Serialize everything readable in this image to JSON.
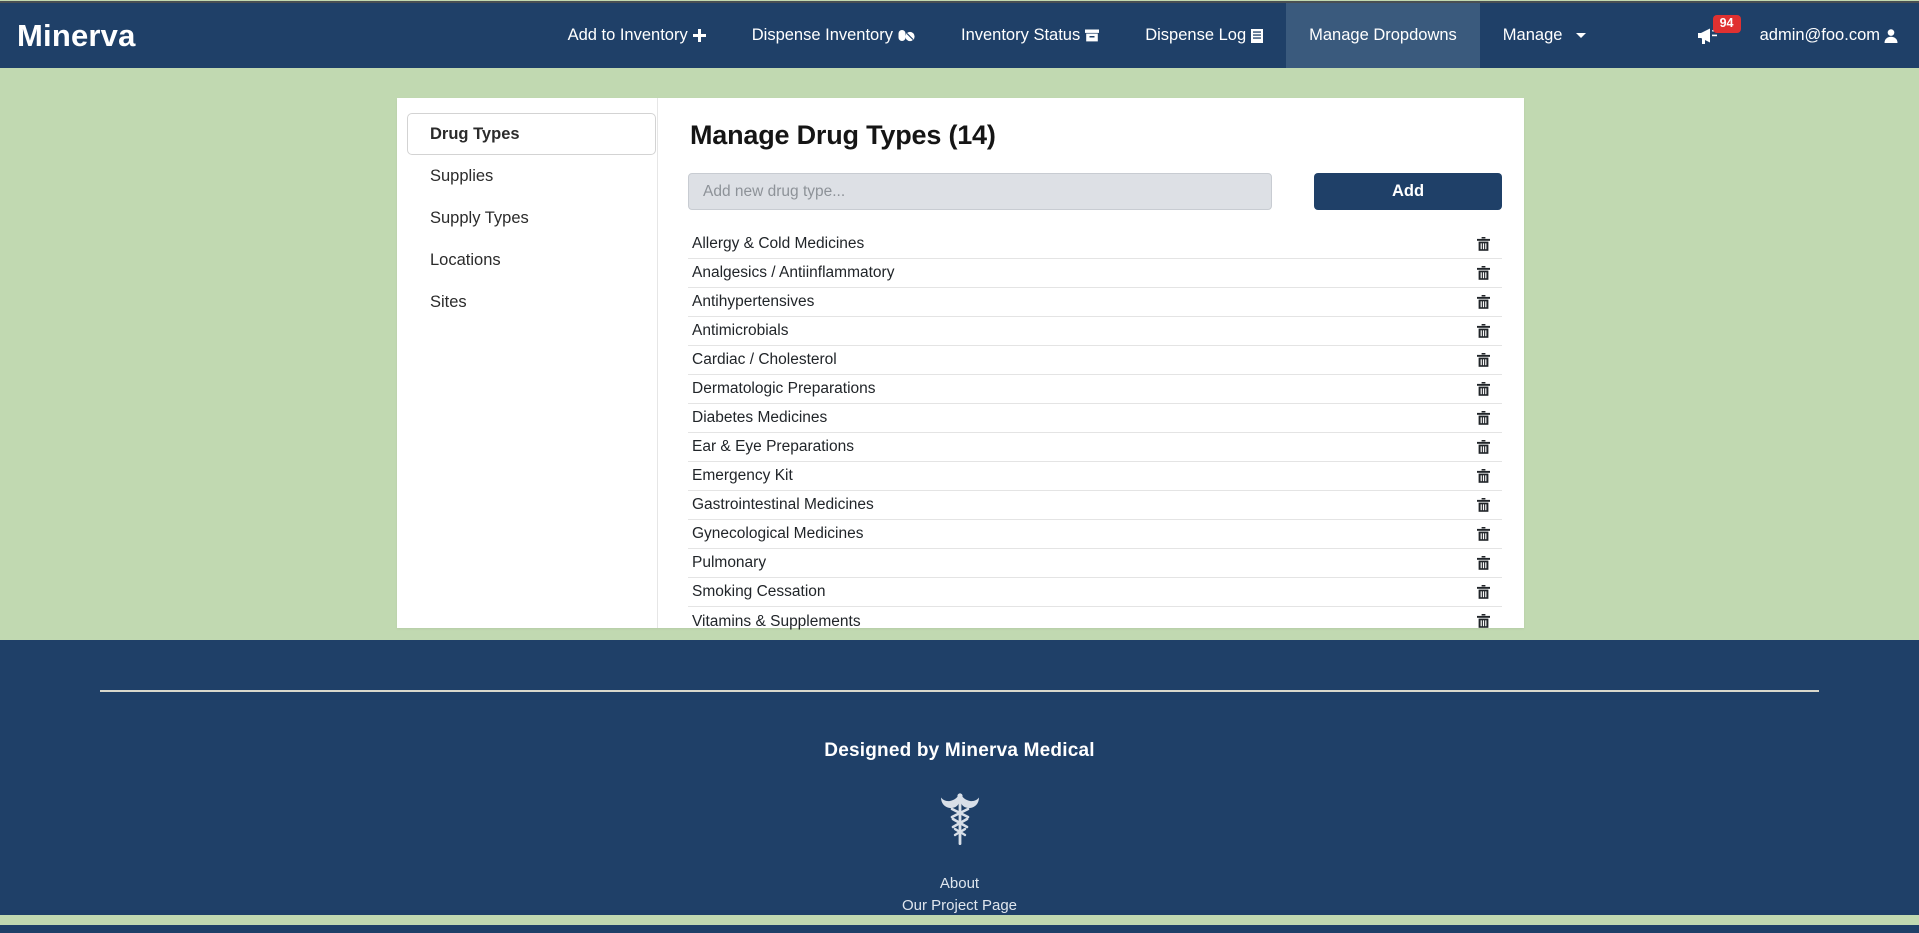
{
  "navbar": {
    "brand": "Minerva",
    "items": [
      {
        "label": "Add to Inventory",
        "icon": "plus-icon",
        "glyph": "✚",
        "active": false
      },
      {
        "label": "Dispense Inventory",
        "icon": "pill-icon",
        "glyph": "💊",
        "active": false
      },
      {
        "label": "Inventory Status",
        "icon": "archive-box-icon",
        "glyph": "▣",
        "active": false
      },
      {
        "label": "Dispense Log",
        "icon": "list-document-icon",
        "glyph": "▤",
        "active": false
      },
      {
        "label": "Manage Dropdowns",
        "icon": "",
        "glyph": "",
        "active": true
      },
      {
        "label": "Manage",
        "icon": "chevron-down-icon",
        "glyph": "",
        "active": false,
        "has_caret": true
      }
    ],
    "notifications": {
      "icon": "megaphone-icon",
      "count": "94"
    },
    "user": {
      "email": "admin@foo.com",
      "icon": "user-avatar-icon"
    }
  },
  "sidebar": {
    "items": [
      {
        "label": "Drug Types",
        "active": true
      },
      {
        "label": "Supplies",
        "active": false
      },
      {
        "label": "Supply Types",
        "active": false
      },
      {
        "label": "Locations",
        "active": false
      },
      {
        "label": "Sites",
        "active": false
      }
    ]
  },
  "main": {
    "title": "Manage Drug Types (14)",
    "add_form": {
      "placeholder": "Add new drug type...",
      "value": "",
      "button_label": "Add"
    },
    "drug_types": [
      "Allergy & Cold Medicines",
      "Analgesics / Antiinflammatory",
      "Antihypertensives",
      "Antimicrobials",
      "Cardiac / Cholesterol",
      "Dermatologic Preparations",
      "Diabetes Medicines",
      "Ear & Eye Preparations",
      "Emergency Kit",
      "Gastrointestinal Medicines",
      "Gynecological Medicines",
      "Pulmonary",
      "Smoking Cessation",
      "Vitamins & Supplements"
    ],
    "row_action_icon": "trash-icon"
  },
  "footer": {
    "title": "Designed by Minerva Medical",
    "logo_icon": "caduceus-icon",
    "links": [
      {
        "label": "About"
      },
      {
        "label": "Our Project Page"
      }
    ]
  },
  "colors": {
    "navy": "#1f4068",
    "navy_active": "#3a5a7d",
    "page_background": "#c1d9b1",
    "badge_red": "#e03131",
    "card_white": "#ffffff",
    "input_gray": "#dde0e5"
  }
}
